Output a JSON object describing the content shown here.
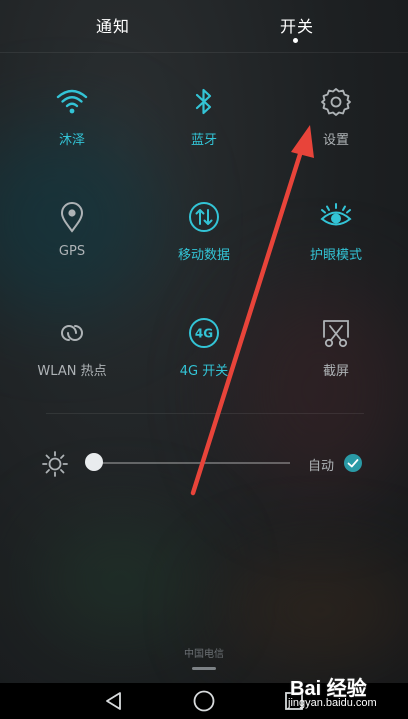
{
  "tabs": [
    {
      "label": "通知",
      "active": false
    },
    {
      "label": "开关",
      "active": true
    }
  ],
  "toggles": [
    {
      "label": "沐泽",
      "icon": "wifi-icon",
      "state": "on"
    },
    {
      "label": "蓝牙",
      "icon": "bluetooth-icon",
      "state": "on"
    },
    {
      "label": "设置",
      "icon": "gear-icon",
      "state": "off"
    },
    {
      "label": "GPS",
      "icon": "location-pin-icon",
      "state": "off"
    },
    {
      "label": "移动数据",
      "icon": "mobile-data-icon",
      "state": "on"
    },
    {
      "label": "护眼模式",
      "icon": "eye-icon",
      "state": "on"
    },
    {
      "label": "WLAN 热点",
      "icon": "hotspot-icon",
      "state": "off"
    },
    {
      "label": "4G 开关",
      "icon": "4g-icon",
      "state": "on"
    },
    {
      "label": "截屏",
      "icon": "screenshot-icon",
      "state": "off"
    }
  ],
  "brightness": {
    "icon": "sun-icon",
    "level": 0,
    "auto_label": "自动",
    "auto_checked": true
  },
  "carrier": "中国电信",
  "navbar": {
    "buttons": [
      "back-icon",
      "home-icon",
      "recents-icon"
    ]
  },
  "watermark": {
    "brand": "Bai 经验",
    "site": "jingyan.baidu.com"
  },
  "colors": {
    "accent": "#33c4d6",
    "inactive": "#aeb3b6",
    "annotation": "#e8443a"
  }
}
